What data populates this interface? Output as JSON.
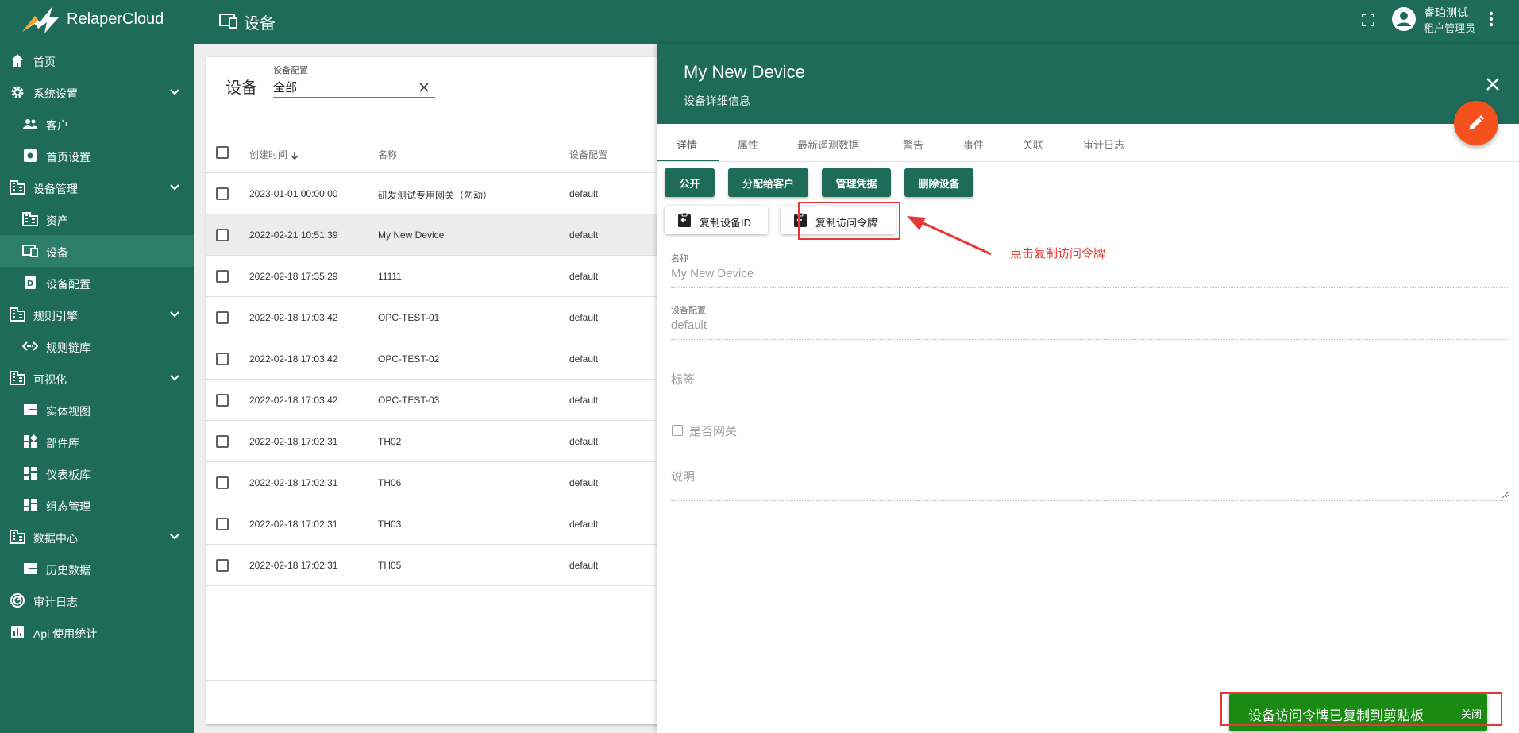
{
  "app": {
    "brand": "RelaperCloud",
    "page_title": "设备"
  },
  "user": {
    "name": "睿珀测试",
    "role": "租户管理员"
  },
  "sidebar": {
    "items": [
      {
        "label": "首页"
      },
      {
        "label": "系统设置"
      },
      {
        "label": "客户"
      },
      {
        "label": "首页设置"
      },
      {
        "label": "设备管理"
      },
      {
        "label": "资产"
      },
      {
        "label": "设备",
        "active": true
      },
      {
        "label": "设备配置"
      },
      {
        "label": "规则引擎"
      },
      {
        "label": "规则链库"
      },
      {
        "label": "可视化"
      },
      {
        "label": "实体视图"
      },
      {
        "label": "部件库"
      },
      {
        "label": "仪表板库"
      },
      {
        "label": "组态管理"
      },
      {
        "label": "数据中心"
      },
      {
        "label": "历史数据"
      },
      {
        "label": "审计日志"
      },
      {
        "label": "Api 使用统计"
      }
    ]
  },
  "devices": {
    "title": "设备",
    "filter": {
      "label": "设备配置",
      "value": "全部"
    },
    "columns": {
      "created": "创建时间",
      "name": "名称",
      "profile": "设备配置"
    },
    "rows": [
      {
        "created": "2023-01-01 00:00:00",
        "name": "研发测试专用网关（勿动）",
        "profile": "default"
      },
      {
        "created": "2022-02-21 10:51:39",
        "name": "My New Device",
        "profile": "default",
        "selected": true
      },
      {
        "created": "2022-02-18 17:35:29",
        "name": "11111",
        "profile": "default"
      },
      {
        "created": "2022-02-18 17:03:42",
        "name": "OPC-TEST-01",
        "profile": "default"
      },
      {
        "created": "2022-02-18 17:03:42",
        "name": "OPC-TEST-02",
        "profile": "default"
      },
      {
        "created": "2022-02-18 17:03:42",
        "name": "OPC-TEST-03",
        "profile": "default"
      },
      {
        "created": "2022-02-18 17:02:31",
        "name": "TH02",
        "profile": "default"
      },
      {
        "created": "2022-02-18 17:02:31",
        "name": "TH06",
        "profile": "default"
      },
      {
        "created": "2022-02-18 17:02:31",
        "name": "TH03",
        "profile": "default"
      },
      {
        "created": "2022-02-18 17:02:31",
        "name": "TH05",
        "profile": "default"
      }
    ]
  },
  "detail": {
    "title": "My New Device",
    "subtitle": "设备详细信息",
    "tabs": [
      "详情",
      "属性",
      "最新遥测数据",
      "警告",
      "事件",
      "关联",
      "审计日志"
    ],
    "buttons": {
      "public": "公开",
      "assign": "分配给客户",
      "credentials": "管理凭据",
      "delete": "删除设备",
      "copy_id": "复制设备ID",
      "copy_token": "复制访问令牌"
    },
    "fields": {
      "name_label": "名称",
      "name_value": "My New Device",
      "profile_label": "设备配置",
      "profile_value": "default",
      "label_placeholder": "标签",
      "gateway_label": "是否网关",
      "description_placeholder": "说明"
    }
  },
  "annotation": {
    "text": "点击复制访问令牌",
    "color": "#e53935"
  },
  "snackbar": {
    "message": "设备访问令牌已复制到剪贴板",
    "action": "关闭",
    "color": "#1b8a13"
  },
  "colors": {
    "primary": "#1d6b58",
    "accent": "#f4511e"
  }
}
